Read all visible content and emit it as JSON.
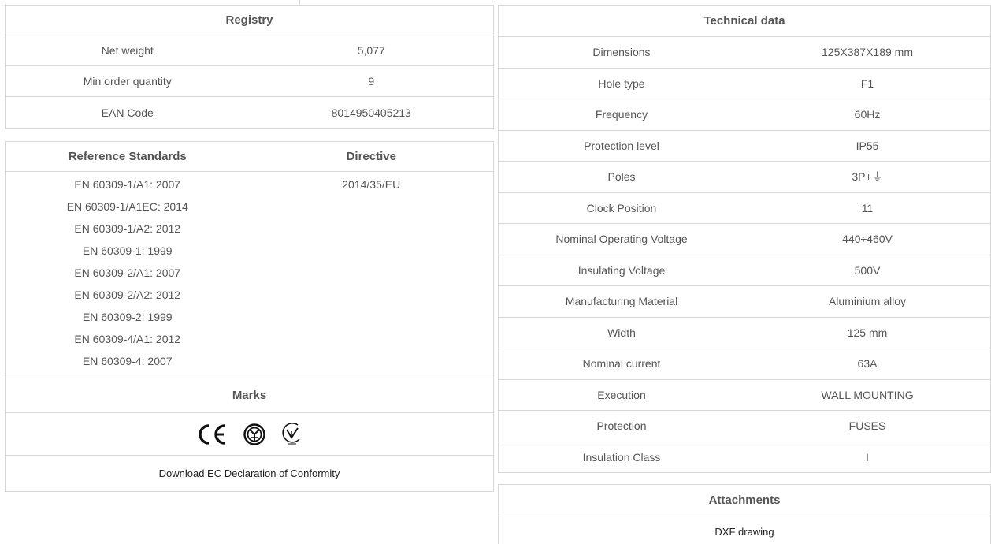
{
  "registry": {
    "title": "Registry",
    "rows": [
      {
        "label": "Net weight",
        "value": "5,077"
      },
      {
        "label": "Min order quantity",
        "value": "9"
      },
      {
        "label": "EAN Code",
        "value": "8014950405213"
      }
    ]
  },
  "standards": {
    "col1_title": "Reference Standards",
    "col2_title": "Directive",
    "items": [
      "EN 60309-1/A1: 2007",
      "EN 60309-1/A1EC: 2014",
      "EN 60309-1/A2: 2012",
      "EN 60309-1: 1999",
      "EN 60309-2/A1: 2007",
      "EN 60309-2/A2: 2012",
      "EN 60309-2: 1999",
      "EN 60309-4/A1: 2012",
      "EN 60309-4: 2007"
    ],
    "directive": "2014/35/EU",
    "marks_title": "Marks",
    "marks": [
      "ce-mark-icon",
      "imq-mark-icon",
      "eac-mark-icon"
    ],
    "download_label": "Download EC Declaration of Conformity"
  },
  "technical": {
    "title": "Technical data",
    "rows": [
      {
        "label": "Dimensions",
        "value": "125X387X189 mm"
      },
      {
        "label": "Hole type",
        "value": "F1"
      },
      {
        "label": "Frequency",
        "value": "60Hz"
      },
      {
        "label": "Protection level",
        "value": "IP55"
      },
      {
        "label": "Poles",
        "value": "3P+⏚"
      },
      {
        "label": "Clock Position",
        "value": "11"
      },
      {
        "label": "Nominal Operating Voltage",
        "value": "440÷460V"
      },
      {
        "label": "Insulating Voltage",
        "value": "500V"
      },
      {
        "label": "Manufacturing Material",
        "value": "Aluminium alloy"
      },
      {
        "label": "Width",
        "value": "125 mm"
      },
      {
        "label": "Nominal current",
        "value": "63A"
      },
      {
        "label": "Execution",
        "value": "WALL MOUNTING"
      },
      {
        "label": "Protection",
        "value": "FUSES"
      },
      {
        "label": "Insulation Class",
        "value": "I"
      }
    ]
  },
  "attachments": {
    "title": "Attachments",
    "dxf_label": "DXF drawing"
  }
}
